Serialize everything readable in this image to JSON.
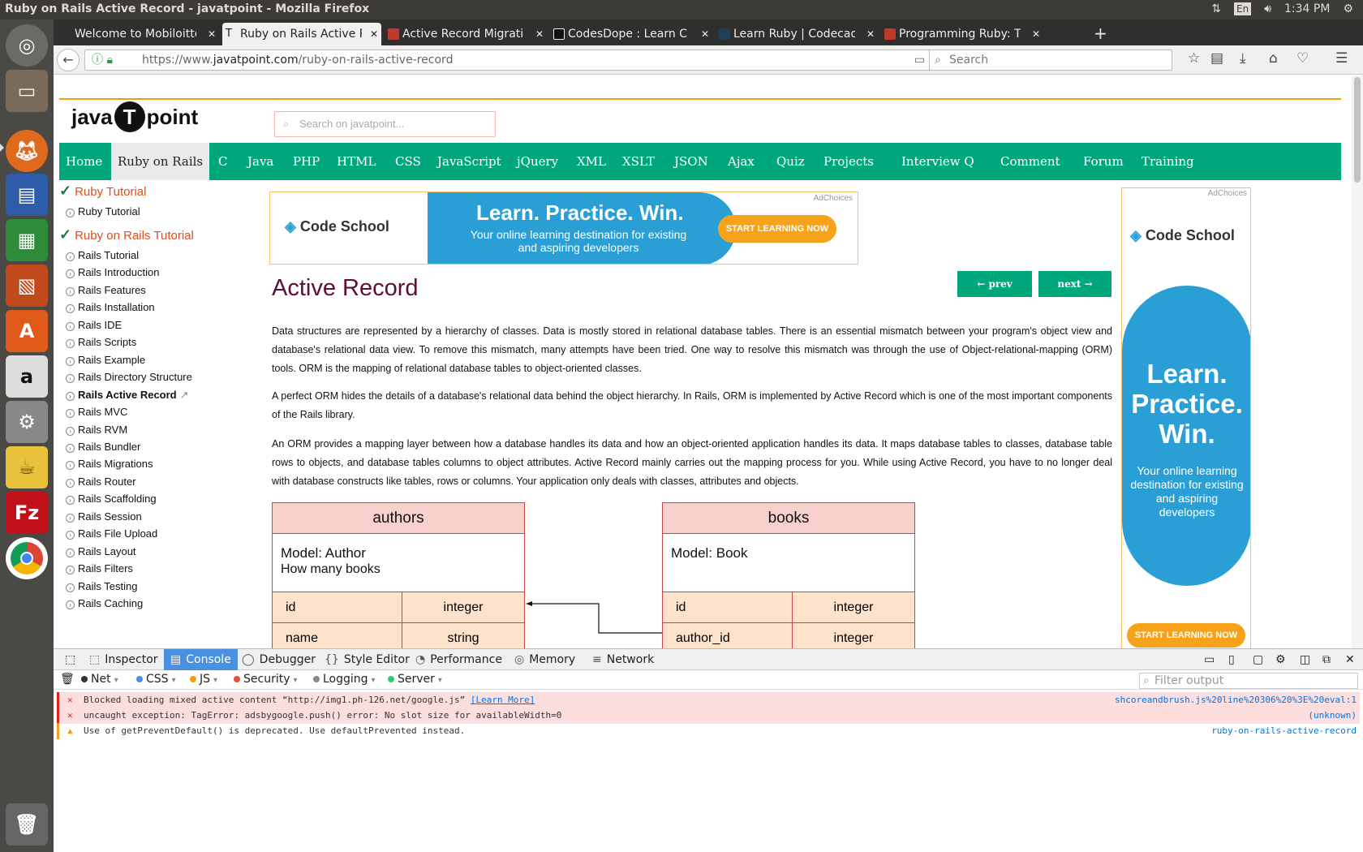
{
  "os": {
    "window_title": "Ruby on Rails Active Record - javatpoint - Mozilla Firefox",
    "lang": "En",
    "time": "1:34 PM"
  },
  "tabs": [
    {
      "label": "Welcome to Mobiloitte",
      "fav_color": "#2f2f2d"
    },
    {
      "label": "Ruby on Rails Active Re",
      "fav_color": "#f0f0ef"
    },
    {
      "label": "Active Record Migratio",
      "fav_color": "#c0392b"
    },
    {
      "label": "CodesDope : Learn C C",
      "fav_color": "#111111"
    },
    {
      "label": "Learn Ruby | Codecade",
      "fav_color": "#1f4056"
    },
    {
      "label": "Programming Ruby: Th",
      "fav_color": "#c0392b"
    }
  ],
  "nav": {
    "url_scheme": "https://www.",
    "url_host": "javatpoint.com",
    "url_path": "/ruby-on-rails-active-record",
    "search_placeholder": "Search"
  },
  "site": {
    "logo_left": "java",
    "logo_mid": "T",
    "logo_right": "point",
    "search_placeholder": "Search on javatpoint...",
    "menu": [
      "Home",
      "Ruby on Rails",
      "C",
      "Java",
      "PHP",
      "HTML",
      "CSS",
      "JavaScript",
      "jQuery",
      "XML",
      "XSLT",
      "JSON",
      "Ajax",
      "Quiz",
      "Projects",
      "Interview Q",
      "Comment",
      "Forum",
      "Training"
    ]
  },
  "sidebar": {
    "head1": "Ruby Tutorial",
    "group1": [
      "Ruby Tutorial"
    ],
    "head2": "Ruby on Rails Tutorial",
    "group2": [
      "Rails Tutorial",
      "Rails Introduction",
      "Rails Features",
      "Rails Installation",
      "Rails IDE",
      "Rails Scripts",
      "Rails Example",
      "Rails Directory Structure",
      "Rails Active Record",
      "Rails MVC",
      "Rails RVM",
      "Rails Bundler",
      "Rails Migrations",
      "Rails Router",
      "Rails Scaffolding",
      "Rails Session",
      "Rails File Upload",
      "Rails Layout",
      "Rails Filters",
      "Rails Testing",
      "Rails Caching"
    ]
  },
  "ad_top": {
    "adchoices": "AdChoices",
    "brand": "Code School",
    "headline": "Learn. Practice. Win.",
    "sub": "Your online learning destination for existing and aspiring developers",
    "cta": "START LEARNING NOW"
  },
  "ad_right": {
    "adchoices": "AdChoices",
    "brand": "Code School",
    "headline": "Learn. Practice. Win.",
    "sub": "Your online learning destination for existing and aspiring developers",
    "cta": "START LEARNING NOW"
  },
  "article": {
    "title": "Active Record",
    "prev": "← prev",
    "next": "next →",
    "p1": "Data structures are represented by a hierarchy of classes. Data is mostly stored in relational database tables. There is an essential mismatch between your program's object view and database's relational data view. To remove this mismatch, many attempts have been tried. One way to resolve this mismatch was through the use of Object-relational-mapping (ORM) tools. ORM is the mapping of relational database tables to object-oriented classes.",
    "p2": "A perfect ORM hides the details of a database's relational data behind the object hierarchy. In Rails, ORM is implemented by Active Record which is one of the most important components of the Rails library.",
    "p3": "An ORM provides a mapping layer between how a database handles its data and how an object-oriented application handles its data. It maps database tables to classes, database table rows to objects, and database tables columns to object attributes. Active Record mainly carries out the mapping process for you. While using Active Record, you have to no longer deal with database constructs like tables, rows or columns. Your application only deals with classes, attributes and objects."
  },
  "diagram": {
    "authors": {
      "name": "authors",
      "model": "Model: Author",
      "note": "How many books",
      "rows": [
        [
          "id",
          "integer"
        ],
        [
          "name",
          "string"
        ]
      ]
    },
    "books": {
      "name": "books",
      "model": "Model: Book",
      "note": "",
      "rows": [
        [
          "id",
          "integer"
        ],
        [
          "author_id",
          "integer"
        ]
      ]
    }
  },
  "devtools": {
    "tabs": [
      "Inspector",
      "Console",
      "Debugger",
      "Style Editor",
      "Performance",
      "Memory",
      "Network"
    ],
    "tab_glyphs": [
      "⬚",
      "▤",
      "◯",
      "{}",
      "◔",
      "◎",
      "≡"
    ],
    "active_tab": "Console",
    "filters": [
      {
        "label": "Net",
        "color": "#333333"
      },
      {
        "label": "CSS",
        "color": "#4a90e2"
      },
      {
        "label": "JS",
        "color": "#f39c12"
      },
      {
        "label": "Security",
        "color": "#e74c3c"
      },
      {
        "label": "Logging",
        "color": "#888888"
      },
      {
        "label": "Server",
        "color": "#2ecc71"
      }
    ],
    "filter_placeholder": "Filter output",
    "logs": [
      {
        "type": "error",
        "icon": "✕",
        "msg": "Blocked loading mixed active content “http://img1.ph-126.net/google.js”",
        "link": "[Learn More]",
        "src": "shcoreandbrush.js%20line%20306%20%3E%20eval:1"
      },
      {
        "type": "error",
        "icon": "✕",
        "msg": "uncaught exception: TagError: adsbygoogle.push() error: No slot size for availableWidth=0",
        "link": "",
        "src": "(unknown)"
      },
      {
        "type": "warn",
        "icon": "▲",
        "msg": "Use of getPreventDefault() is deprecated.  Use defaultPrevented instead.",
        "link": "",
        "src": "ruby-on-rails-active-record"
      }
    ]
  }
}
